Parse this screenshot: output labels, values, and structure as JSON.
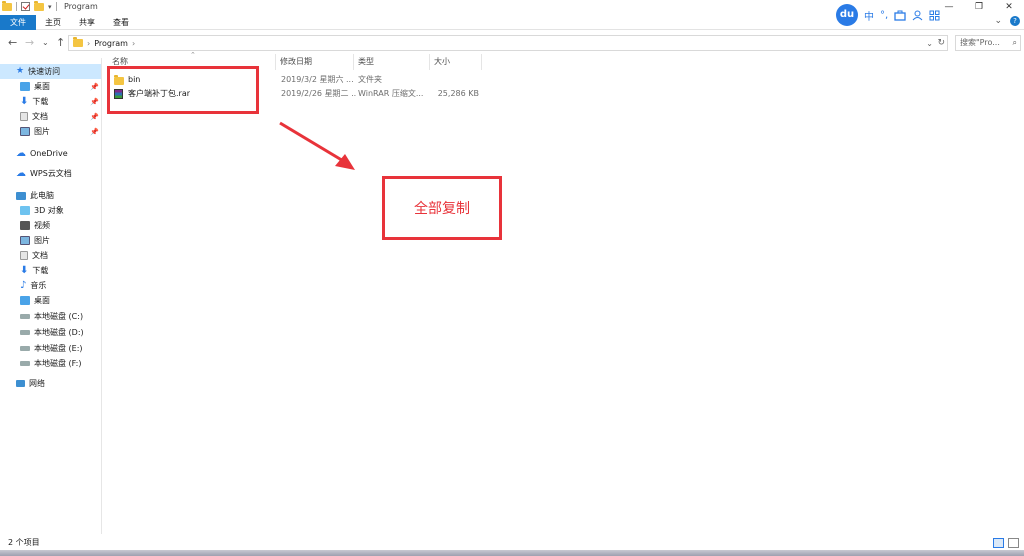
{
  "window": {
    "title": "Program",
    "minimize": "—",
    "restore": "❐",
    "close": "✕"
  },
  "ribbon": {
    "tabs": [
      "文件",
      "主页",
      "共享",
      "查看"
    ],
    "help": "?"
  },
  "ime": {
    "logo": "du",
    "items": [
      "中",
      "°,"
    ]
  },
  "address": {
    "back": "←",
    "forward": "→",
    "recent": "⌄",
    "up": "↑",
    "path": [
      "Program"
    ],
    "refresh": "↻",
    "search_placeholder": "搜索\"Pro..."
  },
  "nav": {
    "quick_access": "快速访问",
    "quick_items": [
      "桌面",
      "下载",
      "文档",
      "图片"
    ],
    "onedrive": "OneDrive",
    "wps": "WPS云文档",
    "this_pc": "此电脑",
    "pc_items": [
      "3D 对象",
      "视频",
      "图片",
      "文档",
      "下载",
      "音乐",
      "桌面",
      "本地磁盘 (C:)",
      "本地磁盘 (D:)",
      "本地磁盘 (E:)",
      "本地磁盘 (F:)"
    ],
    "network": "网络"
  },
  "columns": {
    "name": "名称",
    "date": "修改日期",
    "type": "类型",
    "size": "大小"
  },
  "files": [
    {
      "name": "bin",
      "date": "2019/3/2 星期六 ...",
      "type": "文件夹",
      "size": ""
    },
    {
      "name": "客户端补丁包.rar",
      "date": "2019/2/26 星期二 ...",
      "type": "WinRAR 压缩文...",
      "size": "25,286 KB"
    }
  ],
  "annotation": {
    "text": "全部复制",
    "color": "#e8333a"
  },
  "status": {
    "count": "2 个项目"
  }
}
